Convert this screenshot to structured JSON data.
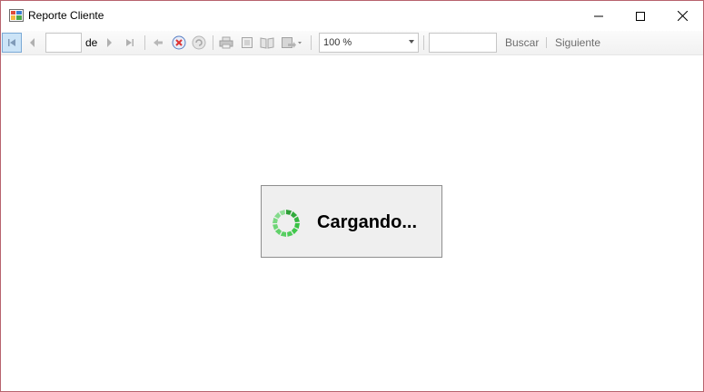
{
  "window": {
    "title": "Reporte Cliente",
    "border_color": "#b8636e"
  },
  "toolbar": {
    "page_value": "",
    "of_label": "de",
    "zoom_value": "100 %",
    "search_value": "",
    "find_label": "Buscar",
    "next_label": "Siguiente",
    "icons": [
      "first-page-icon",
      "previous-page-icon",
      "next-page-icon",
      "last-page-icon",
      "back-icon",
      "stop-icon",
      "refresh-icon",
      "print-icon",
      "print-layout-icon",
      "page-setup-icon",
      "export-icon"
    ]
  },
  "loading": {
    "text": "Cargando...",
    "spinner_color": "#3aa648"
  }
}
